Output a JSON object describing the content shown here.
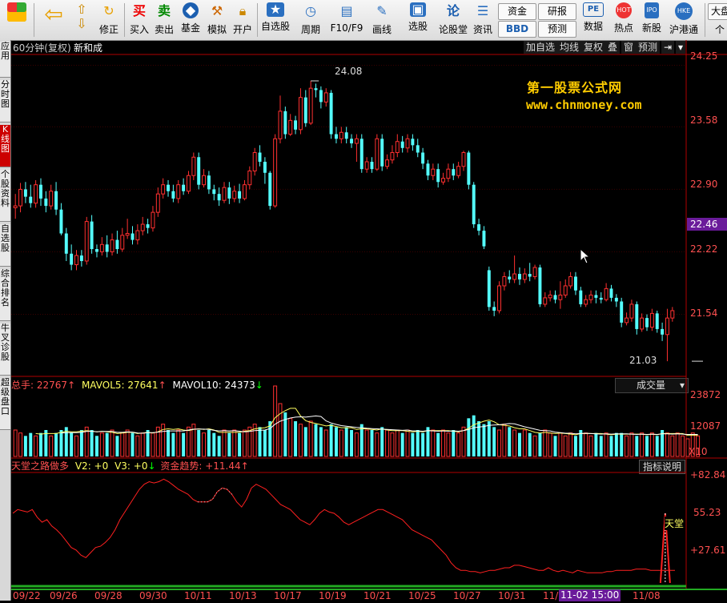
{
  "toolbar": {
    "items": [
      {
        "label": "",
        "icon": "windows-icon"
      },
      {
        "label": "",
        "icon": "back-arrow-icon"
      },
      {
        "label": "修正",
        "icon": "fix-icon"
      },
      {
        "label": "买入",
        "icon": "buy-icon",
        "glyph": "买"
      },
      {
        "label": "卖出",
        "icon": "sell-icon",
        "glyph": "卖"
      },
      {
        "label": "基金",
        "icon": "fund-icon"
      },
      {
        "label": "模拟",
        "icon": "simulate-icon"
      },
      {
        "label": "开户",
        "icon": "lock-icon"
      },
      {
        "label": "自选股",
        "icon": "watchlist-icon"
      },
      {
        "label": "周期",
        "icon": "clock-icon"
      },
      {
        "label": "F10/F9",
        "icon": "f10-icon"
      },
      {
        "label": "画线",
        "icon": "pen-icon"
      },
      {
        "label": "选股",
        "icon": "stock-pick-icon"
      },
      {
        "label": "论股堂",
        "icon": "forum-icon",
        "glyph": "论"
      },
      {
        "label": "资讯",
        "icon": "news-icon"
      },
      {
        "label": "数据",
        "icon": "data-icon",
        "glyph": "PE"
      },
      {
        "label": "热点",
        "icon": "hot-icon",
        "glyph": "HOT"
      },
      {
        "label": "新股",
        "icon": "ipo-icon",
        "glyph": "IPO"
      },
      {
        "label": "沪港通",
        "icon": "hk-connect-icon",
        "glyph": "HKE"
      },
      {
        "label": "个",
        "icon": "more-icon"
      }
    ],
    "small": {
      "capital": "资金",
      "bbd": "BBD",
      "research": "研报",
      "forecast": "预测",
      "dapan": "大盘"
    }
  },
  "left_tabs": [
    "应用",
    "分时图",
    "K线图",
    "个股资料",
    "自选股",
    "综合排名",
    "牛叉诊股",
    "超级盘口"
  ],
  "chart_header": {
    "title": "60分钟(复权)",
    "name": "新和成",
    "buttons": [
      "加自选",
      "均线",
      "复权",
      "叠",
      "窗",
      "预测"
    ]
  },
  "watermark": {
    "line1": "第一股票公式网",
    "line2": "www.chnmoney.com"
  },
  "price_axis": {
    "ticks": [
      "24.25",
      "23.58",
      "22.90",
      "22.22",
      "21.54"
    ],
    "current": "22.46"
  },
  "annotations": {
    "high": "24.08",
    "low": "21.03"
  },
  "volume_header": {
    "total_label": "总手:",
    "total_value": "22767",
    "ma5_label": "MAVOL5:",
    "ma5_value": "27641",
    "ma10_label": "MAVOL10:",
    "ma10_value": "24373",
    "dropdown": "成交量"
  },
  "volume_axis": {
    "ticks": [
      "23872",
      "12087"
    ],
    "unit": "X10"
  },
  "indicator_header": {
    "name": "天堂之路做多",
    "v2": "V2: +0",
    "v3": "V3: +0",
    "trend_label": "资金趋势:",
    "trend_value": "+11.44",
    "explain": "指标说明"
  },
  "indicator_axis": {
    "ticks": [
      "+82.84",
      "55.23",
      "+27.61"
    ],
    "tag": "天堂"
  },
  "date_axis": {
    "labels": [
      "09/22",
      "09/26",
      "09/28",
      "09/30",
      "10/11",
      "10/13",
      "10/17",
      "10/19",
      "10/21",
      "10/25",
      "10/27",
      "10/31",
      "11/0",
      "11/08"
    ],
    "highlight": "11-02 15:00"
  },
  "colors": {
    "up": "#ff3030",
    "down": "#54ffff",
    "axis": "#b00000",
    "text_red": "#ff5050",
    "yellow": "#ffff60"
  },
  "chart_data": {
    "type": "candlestick",
    "ylim": [
      20.9,
      24.35
    ],
    "candles": [
      [
        22.7,
        22.72,
        22.85,
        22.58
      ],
      [
        22.72,
        22.9,
        22.97,
        22.65
      ],
      [
        22.9,
        22.82,
        22.98,
        22.75
      ],
      [
        22.82,
        22.75,
        22.95,
        22.7
      ],
      [
        22.75,
        22.95,
        23.0,
        22.7
      ],
      [
        22.95,
        22.8,
        23.02,
        22.72
      ],
      [
        22.8,
        22.72,
        22.88,
        22.65
      ],
      [
        22.72,
        22.88,
        22.95,
        22.68
      ],
      [
        22.88,
        22.68,
        22.98,
        22.62
      ],
      [
        22.68,
        22.42,
        22.75,
        22.4
      ],
      [
        22.42,
        22.2,
        22.48,
        22.12
      ],
      [
        22.2,
        22.08,
        22.3,
        22.02
      ],
      [
        22.08,
        22.18,
        22.24,
        22.02
      ],
      [
        22.18,
        22.12,
        22.24,
        22.06
      ],
      [
        22.12,
        22.55,
        22.6,
        22.08
      ],
      [
        22.55,
        22.25,
        22.62,
        22.2
      ],
      [
        22.25,
        22.22,
        22.3,
        22.16
      ],
      [
        22.22,
        22.3,
        22.38,
        22.18
      ],
      [
        22.3,
        22.22,
        22.4,
        22.16
      ],
      [
        22.22,
        22.35,
        22.42,
        22.18
      ],
      [
        22.35,
        22.25,
        22.45,
        22.2
      ],
      [
        22.25,
        22.4,
        22.48,
        22.22
      ],
      [
        22.4,
        22.42,
        22.58,
        22.36
      ],
      [
        22.42,
        22.35,
        22.5,
        22.3
      ],
      [
        22.35,
        22.45,
        22.52,
        22.3
      ],
      [
        22.45,
        22.52,
        22.6,
        22.4
      ],
      [
        22.52,
        22.48,
        22.58,
        22.42
      ],
      [
        22.48,
        22.65,
        22.72,
        22.44
      ],
      [
        22.65,
        22.85,
        22.92,
        22.6
      ],
      [
        22.85,
        22.95,
        23.02,
        22.8
      ],
      [
        22.95,
        22.88,
        23.0,
        22.82
      ],
      [
        22.88,
        22.8,
        22.95,
        22.76
      ],
      [
        22.8,
        22.95,
        23.0,
        22.75
      ],
      [
        22.95,
        22.88,
        23.02,
        22.84
      ],
      [
        22.88,
        23.05,
        23.1,
        22.85
      ],
      [
        23.05,
        23.25,
        23.3,
        23.0
      ],
      [
        23.25,
        22.95,
        23.3,
        22.9
      ],
      [
        22.95,
        23.05,
        23.12,
        22.92
      ],
      [
        23.05,
        22.9,
        23.1,
        22.85
      ],
      [
        22.9,
        22.85,
        22.95,
        22.78
      ],
      [
        22.85,
        22.78,
        22.92,
        22.72
      ],
      [
        22.78,
        22.92,
        22.98,
        22.75
      ],
      [
        22.92,
        22.8,
        22.98,
        22.74
      ],
      [
        22.8,
        22.88,
        22.94,
        22.76
      ],
      [
        22.88,
        22.8,
        22.96,
        22.75
      ],
      [
        22.8,
        22.95,
        23.0,
        22.78
      ],
      [
        22.95,
        23.1,
        23.15,
        22.9
      ],
      [
        23.1,
        23.3,
        23.35,
        23.05
      ],
      [
        23.3,
        23.2,
        23.38,
        23.15
      ],
      [
        23.2,
        23.08,
        23.25,
        22.96
      ],
      [
        23.08,
        22.72,
        23.1,
        22.68
      ],
      [
        22.72,
        23.45,
        23.5,
        22.7
      ],
      [
        23.45,
        23.75,
        23.92,
        23.4
      ],
      [
        23.75,
        23.5,
        23.8,
        23.45
      ],
      [
        23.5,
        23.65,
        23.72,
        23.48
      ],
      [
        23.65,
        23.55,
        23.7,
        23.5
      ],
      [
        23.55,
        23.9,
        24.0,
        23.5
      ],
      [
        23.9,
        23.62,
        23.98,
        23.58
      ],
      [
        23.62,
        24.0,
        24.08,
        23.6
      ],
      [
        24.0,
        23.98,
        24.05,
        23.9
      ],
      [
        23.98,
        23.85,
        24.02,
        23.78
      ],
      [
        23.85,
        23.95,
        24.0,
        23.8
      ],
      [
        23.95,
        23.5,
        23.98,
        23.45
      ],
      [
        23.5,
        23.45,
        23.58,
        23.4
      ],
      [
        23.45,
        23.52,
        23.58,
        23.4
      ],
      [
        23.52,
        23.45,
        23.58,
        23.4
      ],
      [
        23.45,
        23.4,
        23.5,
        23.35
      ],
      [
        23.4,
        23.45,
        23.5,
        23.2
      ],
      [
        23.45,
        23.12,
        23.5,
        23.08
      ],
      [
        23.12,
        23.2,
        23.25,
        23.08
      ],
      [
        23.2,
        23.12,
        23.25,
        23.08
      ],
      [
        23.12,
        23.45,
        23.5,
        23.1
      ],
      [
        23.45,
        23.15,
        23.5,
        23.1
      ],
      [
        23.15,
        23.22,
        23.28,
        23.12
      ],
      [
        23.22,
        23.3,
        23.38,
        23.18
      ],
      [
        23.3,
        23.42,
        23.5,
        23.25
      ],
      [
        23.42,
        23.35,
        23.48,
        23.3
      ],
      [
        23.35,
        23.45,
        23.5,
        23.3
      ],
      [
        23.45,
        23.38,
        23.5,
        23.32
      ],
      [
        23.38,
        23.3,
        23.45,
        23.25
      ],
      [
        23.3,
        23.18,
        23.35,
        23.12
      ],
      [
        23.18,
        23.05,
        23.22,
        23.0
      ],
      [
        23.05,
        23.12,
        23.18,
        23.0
      ],
      [
        23.12,
        22.98,
        23.18,
        22.92
      ],
      [
        22.98,
        23.02,
        23.08,
        22.95
      ],
      [
        23.02,
        23.12,
        23.18,
        22.98
      ],
      [
        23.12,
        23.05,
        23.18,
        23.0
      ],
      [
        23.05,
        23.15,
        23.2,
        23.02
      ],
      [
        23.15,
        23.3,
        23.32,
        23.1
      ],
      [
        23.3,
        22.95,
        23.32,
        22.9
      ],
      [
        22.95,
        22.52,
        22.98,
        22.48
      ],
      [
        22.52,
        22.45,
        22.58,
        22.4
      ],
      [
        22.45,
        22.28,
        22.5,
        22.25
      ],
      [
        22.02,
        21.62,
        22.06,
        21.58
      ],
      [
        21.62,
        21.58,
        21.68,
        21.52
      ],
      [
        21.58,
        21.85,
        21.9,
        21.55
      ],
      [
        21.85,
        21.95,
        22.0,
        21.8
      ],
      [
        21.95,
        21.92,
        22.02,
        21.88
      ],
      [
        21.92,
        21.98,
        22.18,
        21.88
      ],
      [
        21.98,
        21.92,
        22.05,
        21.86
      ],
      [
        21.92,
        21.98,
        22.04,
        21.88
      ],
      [
        21.98,
        21.95,
        22.1,
        21.9
      ],
      [
        21.95,
        22.05,
        22.08,
        21.92
      ],
      [
        22.05,
        21.65,
        22.08,
        21.62
      ],
      [
        21.65,
        21.72,
        21.78,
        21.62
      ],
      [
        21.72,
        21.75,
        21.8,
        21.68
      ],
      [
        21.75,
        21.7,
        21.8,
        21.66
      ],
      [
        21.7,
        21.75,
        21.9,
        21.6
      ],
      [
        21.75,
        21.85,
        21.92,
        21.72
      ],
      [
        21.85,
        21.95,
        22.0,
        21.82
      ],
      [
        21.95,
        21.8,
        22.0,
        21.75
      ],
      [
        21.8,
        21.65,
        21.84,
        21.62
      ],
      [
        21.65,
        21.7,
        21.75,
        21.62
      ],
      [
        21.7,
        21.75,
        21.8,
        21.66
      ],
      [
        21.75,
        21.72,
        21.8,
        21.66
      ],
      [
        21.72,
        21.7,
        21.78,
        21.66
      ],
      [
        21.7,
        21.82,
        21.88,
        21.68
      ],
      [
        21.82,
        21.72,
        21.86,
        21.68
      ],
      [
        21.72,
        21.68,
        21.76,
        21.62
      ],
      [
        21.68,
        21.45,
        21.72,
        21.4
      ],
      [
        21.45,
        21.5,
        21.56,
        21.42
      ],
      [
        21.5,
        21.65,
        21.7,
        21.46
      ],
      [
        21.65,
        21.38,
        21.68,
        21.32
      ],
      [
        21.38,
        21.5,
        21.55,
        21.35
      ],
      [
        21.5,
        21.4,
        21.54,
        21.36
      ],
      [
        21.4,
        21.55,
        21.6,
        21.36
      ],
      [
        21.55,
        21.38,
        21.58,
        21.34
      ],
      [
        21.38,
        21.32,
        21.45,
        21.25
      ],
      [
        21.32,
        21.5,
        21.6,
        21.03
      ],
      [
        21.5,
        21.58,
        21.62,
        21.46
      ]
    ],
    "volume": [
      9,
      8,
      7,
      8,
      7,
      8,
      9,
      7,
      8,
      9,
      10,
      8,
      7,
      9,
      10,
      9,
      7,
      8,
      8,
      9,
      7,
      8,
      9,
      8,
      7,
      8,
      9,
      8,
      10,
      11,
      9,
      8,
      9,
      8,
      10,
      11,
      9,
      8,
      9,
      8,
      7,
      9,
      8,
      9,
      8,
      9,
      10,
      11,
      10,
      9,
      12,
      24,
      18,
      15,
      13,
      12,
      11,
      10,
      12,
      11,
      10,
      9,
      11,
      10,
      9,
      10,
      9,
      8,
      11,
      9,
      9,
      8,
      10,
      9,
      8,
      9,
      8,
      9,
      8,
      9,
      8,
      10,
      9,
      8,
      9,
      8,
      9,
      8,
      10,
      13,
      14,
      12,
      11,
      12,
      10,
      9,
      11,
      10,
      9,
      8,
      9,
      8,
      7,
      8,
      9,
      8,
      7,
      8,
      7,
      8,
      7,
      9,
      8,
      7,
      8,
      7,
      8,
      7,
      8,
      8,
      7,
      8,
      7,
      8,
      7,
      8,
      7,
      9,
      8,
      7,
      8,
      7,
      6,
      8,
      7
    ],
    "mavol5": [
      8.5,
      8.4,
      8.3,
      8.2,
      8.4,
      8.3,
      8.6,
      8.2,
      8.0,
      8.4,
      8.6,
      9.0,
      9.4,
      10.2,
      12.4,
      13.8,
      14.0,
      12.0,
      10.4,
      9.8,
      9.4,
      9.0,
      8.6,
      8.4,
      8.2,
      8.0
    ],
    "indicator": [
      55,
      58,
      57,
      56,
      58,
      52,
      48,
      50,
      45,
      42,
      38,
      33,
      28,
      26,
      22,
      20,
      24,
      28,
      29,
      32,
      36,
      42,
      50,
      56,
      62,
      68,
      74,
      78,
      80,
      79,
      80,
      82,
      80,
      77,
      74,
      72,
      70,
      66,
      64,
      64,
      64,
      66,
      72,
      75,
      74,
      70,
      64,
      60,
      66,
      75,
      78,
      76,
      74,
      70,
      66,
      62,
      60,
      58,
      54,
      50,
      48,
      46,
      50,
      55,
      58,
      56,
      55,
      52,
      48,
      46,
      48,
      50,
      52,
      54,
      56,
      58,
      58,
      56,
      54,
      52,
      50,
      46,
      42,
      40,
      38,
      36,
      34,
      30,
      26,
      22,
      16,
      12,
      10,
      10,
      9,
      9,
      8,
      9,
      10,
      10,
      11,
      12,
      12,
      14,
      14,
      13,
      12,
      11,
      10,
      10,
      12,
      10,
      9,
      10,
      9,
      8,
      10,
      9,
      8,
      8,
      8,
      8,
      9,
      9,
      10,
      10,
      10,
      10,
      11,
      11,
      11,
      10,
      10,
      10,
      10,
      10,
      10
    ],
    "indicator_ylim": [
      0,
      86
    ],
    "spike": {
      "at": 134,
      "value": 55
    }
  }
}
